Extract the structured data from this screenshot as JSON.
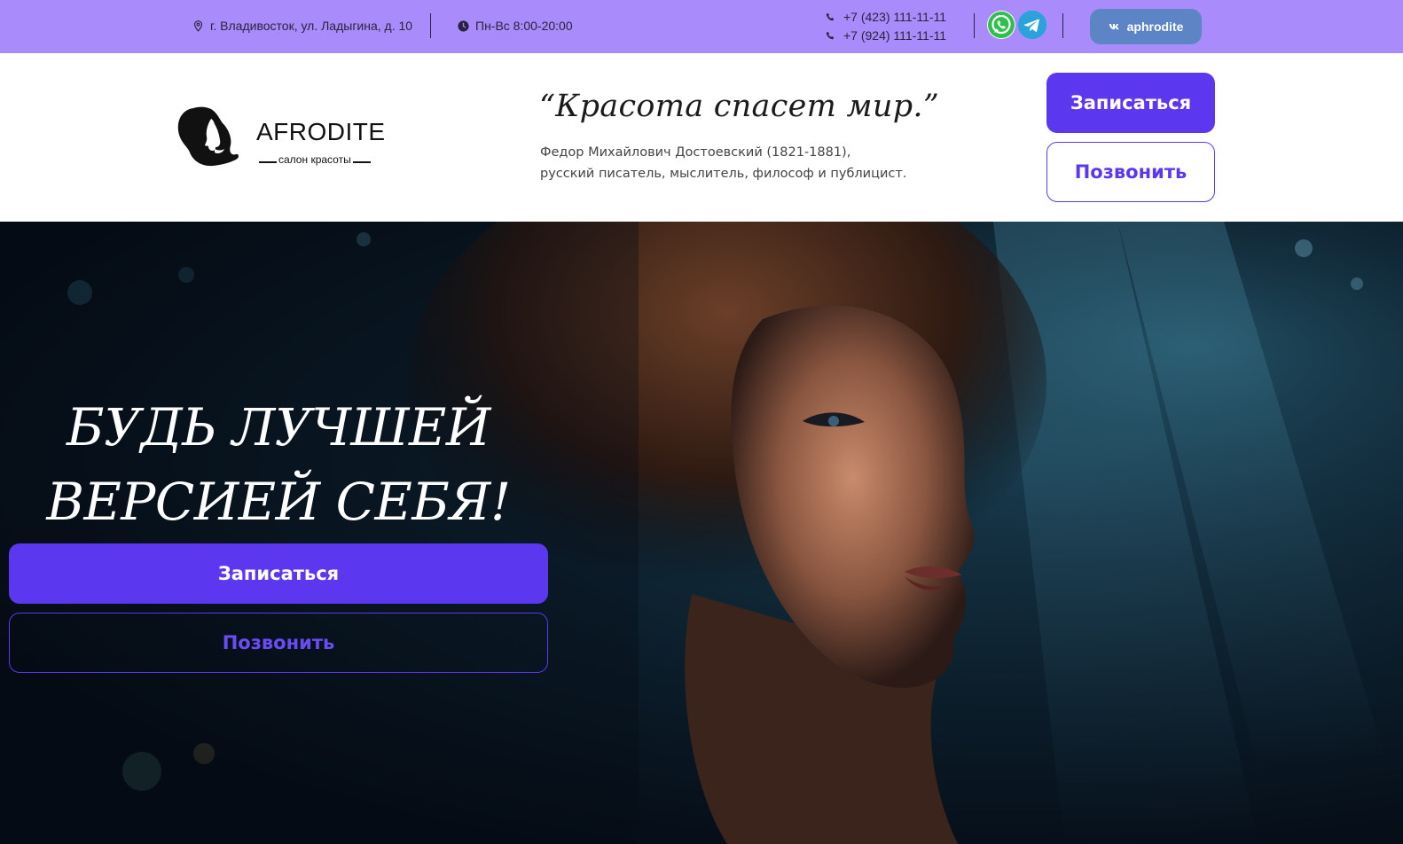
{
  "topbar": {
    "address": "г. Владивосток, ул. Ладыгина, д. 10",
    "hours": "Пн-Вс 8:00-20:00",
    "phones": [
      "+7 (423) 111-11-11",
      "+7 (924) 111-11-11"
    ],
    "messengers": [
      "whatsapp-icon",
      "telegram-icon"
    ],
    "vk_label": "aphrodite"
  },
  "logo": {
    "name": "AFRODITE",
    "tagline": "салон красоты"
  },
  "quote": {
    "text": "“Красота спасет мир.”",
    "author_line1": "Федор Михайлович Достоевский (1821-1881),",
    "author_line2": "русский писатель, мыслитель, философ и публицист."
  },
  "header_buttons": {
    "book": "Записаться",
    "call": "Позвонить"
  },
  "hero": {
    "title_line1": "БУДЬ ЛУЧШЕЙ",
    "title_line2": "ВЕРСИЕЙ СЕБЯ!",
    "book": "Записаться",
    "call": "Позвонить"
  },
  "colors": {
    "topbar_bg": "#a98bfb",
    "accent": "#5b38f0",
    "vk": "#5d84c4"
  }
}
